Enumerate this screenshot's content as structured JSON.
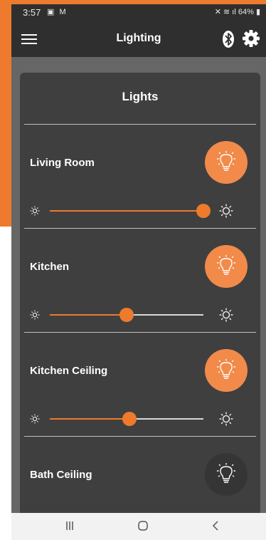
{
  "status": {
    "time": "3:57",
    "left_icons": "▣ M",
    "battery": "64%"
  },
  "app": {
    "title": "Lighting"
  },
  "card": {
    "title": "Lights"
  },
  "lights": [
    {
      "name": "Living Room",
      "state": "on",
      "brightness": 1.0
    },
    {
      "name": "Kitchen",
      "state": "on",
      "brightness": 0.5
    },
    {
      "name": "Kitchen Ceiling",
      "state": "on",
      "brightness": 0.52
    },
    {
      "name": "Bath Ceiling",
      "state": "off"
    }
  ],
  "icons": {
    "menu": "menu-icon",
    "bluetooth": "bluetooth-icon",
    "settings": "gear-icon",
    "bulb": "lightbulb-icon",
    "sun_small": "sun-small-icon",
    "sun_large": "sun-large-icon",
    "nav_recent": "recent-apps-icon",
    "nav_home": "home-icon",
    "nav_back": "back-icon"
  },
  "colors": {
    "accent": "#ee7a2d",
    "bulb_on": "#f28a4a",
    "card": "#3f3f3f",
    "appbar": "#2f2f2f"
  }
}
